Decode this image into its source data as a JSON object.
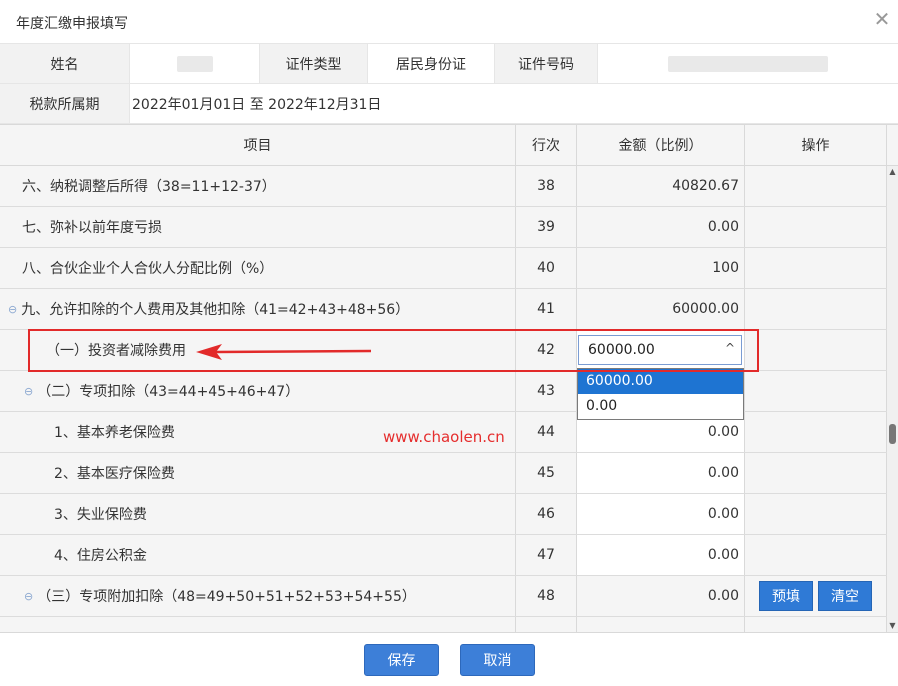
{
  "dialog": {
    "title": "年度汇缴申报填写",
    "close_glyph": "✕"
  },
  "info": {
    "name_label": "姓名",
    "id_type_label": "证件类型",
    "id_type_value": "居民身份证",
    "id_no_label": "证件号码",
    "tax_period_label": "税款所属期",
    "tax_period_value": "2022年01月01日 至 2022年12月31日"
  },
  "table": {
    "headers": {
      "item": "项目",
      "line": "行次",
      "amount": "金额（比例）",
      "action": "操作"
    },
    "rows": [
      {
        "item": "六、纳税调整后所得（38=11+12-37）",
        "line": "38",
        "amount": "40820.67"
      },
      {
        "item": "七、弥补以前年度亏损",
        "line": "39",
        "amount": "0.00"
      },
      {
        "item": "八、合伙企业个人合伙人分配比例（%）",
        "line": "40",
        "amount": "100"
      },
      {
        "item": "九、允许扣除的个人费用及其他扣除（41=42+43+48+56）",
        "line": "41",
        "amount": "60000.00",
        "toggle": "⊖"
      },
      {
        "item": "（一）投资者减除费用",
        "line": "42",
        "amount": ""
      },
      {
        "item": "（二）专项扣除（43=44+45+46+47）",
        "line": "43",
        "amount": "",
        "toggle": "⊖"
      },
      {
        "item": "1、基本养老保险费",
        "line": "44",
        "amount": "0.00"
      },
      {
        "item": "2、基本医疗保险费",
        "line": "45",
        "amount": "0.00"
      },
      {
        "item": "3、失业保险费",
        "line": "46",
        "amount": "0.00"
      },
      {
        "item": "4、住房公积金",
        "line": "47",
        "amount": "0.00"
      },
      {
        "item": "（三）专项附加扣除（48=49+50+51+52+53+54+55）",
        "line": "48",
        "amount": "0.00",
        "toggle": "⊖"
      }
    ],
    "prefill_label": "预填",
    "clear_label": "清空"
  },
  "select": {
    "value": "60000.00",
    "arrow_glyph": "^",
    "options": [
      "60000.00",
      "0.00"
    ],
    "selected_index": 0
  },
  "watermark": "www.chaolen.cn",
  "scrollbar": {
    "up_glyph": "▲",
    "down_glyph": "▼"
  },
  "footer": {
    "save_label": "保存",
    "cancel_label": "取消"
  },
  "colors": {
    "primary": "#2f7ad6",
    "highlight": "#e22a2a",
    "row_bg": "#f5f5f5",
    "option_selected": "#1e74d2"
  }
}
